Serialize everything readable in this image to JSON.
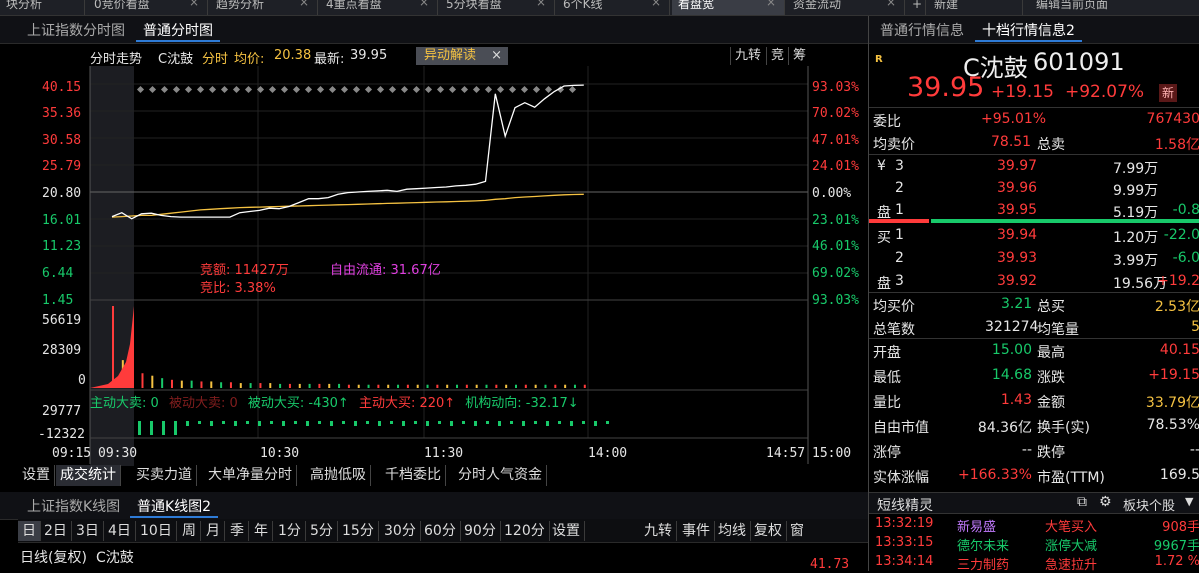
{
  "top_tabs": [
    {
      "label": "块分析"
    },
    {
      "label": "0竞价看盘"
    },
    {
      "label": "趋势分析"
    },
    {
      "label": "4重点看盘"
    },
    {
      "label": "5分块看盘"
    },
    {
      "label": "6个K线"
    },
    {
      "label": "看盘宽",
      "active": true
    },
    {
      "label": "资金流动"
    },
    {
      "label": "新建"
    },
    {
      "label": "编辑当前页面"
    }
  ],
  "left_tabs": {
    "tab1": "上证指数分时图",
    "tab2": "普通分时图"
  },
  "chart_header": {
    "trend": "分时走势",
    "name": "C沈鼓",
    "mode": "分时",
    "avg_label": "均价:",
    "avg_val": "20.38",
    "latest_label": "最新:",
    "latest_val": "39.95",
    "anomaly": "异动解读",
    "btn_jiuzhuan": "九转",
    "btn_jing": "竞",
    "btn_chou": "筹"
  },
  "price_axis_left": [
    "40.15",
    "35.36",
    "30.58",
    "25.79",
    "20.80",
    "16.01",
    "11.23",
    "6.44",
    "1.45"
  ],
  "price_axis_right": [
    "93.03%",
    "70.02%",
    "47.01%",
    "24.01%",
    "0.00%",
    "23.01%",
    "46.01%",
    "69.02%",
    "93.03%"
  ],
  "price_chart": {
    "prev_close": 20.8,
    "min": 1.45,
    "max": 40.15,
    "price": [
      16.4,
      17.1,
      16.0,
      16.9,
      17.0,
      16.6,
      16.4,
      16.3,
      16.3,
      16.3,
      16.3,
      16.3,
      16.3,
      17.1,
      17.3,
      17.5,
      17.9,
      17.8,
      18.2,
      18.9,
      19.6,
      19.6,
      19.8,
      20.4,
      20.7,
      20.8,
      20.9,
      21.0,
      21.1,
      20.9,
      21.3,
      21.4,
      21.5,
      21.6,
      21.7,
      21.9,
      22.0,
      22.2,
      22.7,
      38.4,
      30.8,
      35.9,
      36.8,
      36.0,
      37.5,
      38.8,
      39.8,
      39.9,
      39.95
    ],
    "avg": [
      16.3,
      16.4,
      16.5,
      16.6,
      16.6,
      16.8,
      17.0,
      17.2,
      17.4,
      17.6,
      17.7,
      17.8,
      17.9,
      18.0,
      18.05,
      18.1,
      18.15,
      18.2,
      18.25,
      18.3,
      18.35,
      18.4,
      18.45,
      18.5,
      18.55,
      18.6,
      18.65,
      18.7,
      18.75,
      18.8,
      18.85,
      18.9,
      18.95,
      19.0,
      19.05,
      19.1,
      19.15,
      19.2,
      19.3,
      19.5,
      19.6,
      19.8,
      19.9,
      20.0,
      20.1,
      20.2,
      20.3,
      20.35,
      20.38
    ],
    "total_minutes": 240,
    "elapsed_minutes": 168
  },
  "annotations": {
    "jing_e": "竞额: 11427万",
    "zi_you": "自由流通: 31.67亿",
    "jing_bi": "竞比: 3.38%"
  },
  "volume_axis": [
    "56619",
    "28309",
    "0"
  ],
  "volume_bars": [
    100,
    34,
    22,
    18,
    15,
    12,
    10,
    9,
    9,
    8,
    8,
    7,
    7,
    6,
    6,
    6,
    6,
    5,
    5,
    5,
    5,
    5,
    5,
    5,
    4,
    4,
    4,
    4,
    4,
    4,
    4,
    4,
    4,
    4,
    4,
    4,
    4,
    4,
    4,
    4,
    4,
    4,
    4,
    4,
    4,
    4,
    4,
    4,
    4
  ],
  "flow_labels": {
    "l1": "主动大卖: 0",
    "l2": "被动大卖: 0",
    "l3": "被动大买: -430↑",
    "l4": "主动大买: 220↑",
    "l5": "机构动向: -32.17↓"
  },
  "flow_axis": [
    "29777",
    "-12322"
  ],
  "time_axis": [
    "09:15",
    "09:30",
    "10:30",
    "11:30",
    "14:00",
    "14:57",
    "15:00"
  ],
  "bottom_tabs": [
    "设置",
    "成交统计",
    "买卖力道",
    "大单净量分时",
    "高抛低吸",
    "千档委比",
    "分时人气资金"
  ],
  "kline_tabs": {
    "tab1": "上证指数K线图",
    "tab2": "普通K线图2"
  },
  "kline_toolbar": [
    "日",
    "2日",
    "3日",
    "4日",
    "10日",
    "周",
    "月",
    "季",
    "年",
    "1分",
    "5分",
    "15分",
    "30分",
    "60分",
    "90分",
    "120分",
    "设置"
  ],
  "kline_toolbar_right": [
    "九转",
    "事件",
    "均线",
    "复权",
    "窗"
  ],
  "kline_footer": {
    "label": "日线(复权)",
    "name": "C沈鼓",
    "price": "41.73"
  },
  "right_tabs": {
    "tab1": "普通行情信息",
    "tab2": "十档行情信息2"
  },
  "quote": {
    "badge": "R",
    "name": "C沈鼓",
    "code": "601091",
    "price": "39.95",
    "change": "+19.15",
    "pct": "+92.07%",
    "tag": "新"
  },
  "weibi": {
    "label": "委比",
    "pct": "+95.01%",
    "val": "767430"
  },
  "junmai": {
    "label": "均卖价",
    "val": "78.51",
    "total_label": "总卖",
    "total": "1.58亿"
  },
  "asks": [
    {
      "lv": "3",
      "price": "39.97",
      "vol": "7.99万",
      "chg": ""
    },
    {
      "lv": "2",
      "price": "39.96",
      "vol": "9.99万",
      "chg": ""
    },
    {
      "lv": "1",
      "price": "39.95",
      "vol": "5.19万",
      "chg": "-0.8"
    }
  ],
  "bids": [
    {
      "lv": "1",
      "price": "39.94",
      "vol": "1.20万",
      "chg": "-22.0"
    },
    {
      "lv": "2",
      "price": "39.93",
      "vol": "3.99万",
      "chg": "-6.0"
    },
    {
      "lv": "3",
      "price": "39.92",
      "vol": "19.56万",
      "chg": "+19.2"
    }
  ],
  "ask_side_chars": [
    "¥",
    "",
    "盘"
  ],
  "bid_side_chars": [
    "买",
    "",
    "盘"
  ],
  "junbuy": {
    "label": "均买价",
    "val": "3.21",
    "total_label": "总买",
    "total": "2.53亿"
  },
  "total_bi": {
    "label": "总笔数",
    "val": "321274",
    "lbl2": "均笔量",
    "val2": "5"
  },
  "stats": [
    {
      "k1": "开盘",
      "v1": "15.00",
      "k2": "最高",
      "v2": "40.15"
    },
    {
      "k1": "最低",
      "v1": "14.68",
      "k2": "涨跌",
      "v2": "+19.15"
    },
    {
      "k1": "量比",
      "v1": "1.43",
      "k2": "金额",
      "v2": "33.79亿"
    },
    {
      "k1": "自由市值",
      "v1": "84.36亿",
      "k2": "换手(实)",
      "v2": "78.53%"
    },
    {
      "k1": "涨停",
      "v1": "--",
      "k2": "跌停",
      "v2": "--"
    },
    {
      "k1": "实体涨幅",
      "v1": "+166.33%",
      "k2": "市盈(TTM)",
      "v2": "169.5"
    }
  ],
  "sprite": {
    "title": "短线精灵",
    "sector": "板块个股"
  },
  "sprite_rows": [
    {
      "time": "13:32:19",
      "name": "新易盛",
      "event": "大笔买入",
      "val": "908手"
    },
    {
      "time": "13:33:15",
      "name": "德尔未来",
      "event": "涨停大减",
      "val": "9967手"
    },
    {
      "time": "13:34:14",
      "name": "三力制药",
      "event": "急速拉升",
      "val": "1.72 %"
    }
  ],
  "colors": {
    "up": "#ff3b3b",
    "down": "#18c96a",
    "avg_line": "#f5c242",
    "price_line": "#ffffff"
  }
}
